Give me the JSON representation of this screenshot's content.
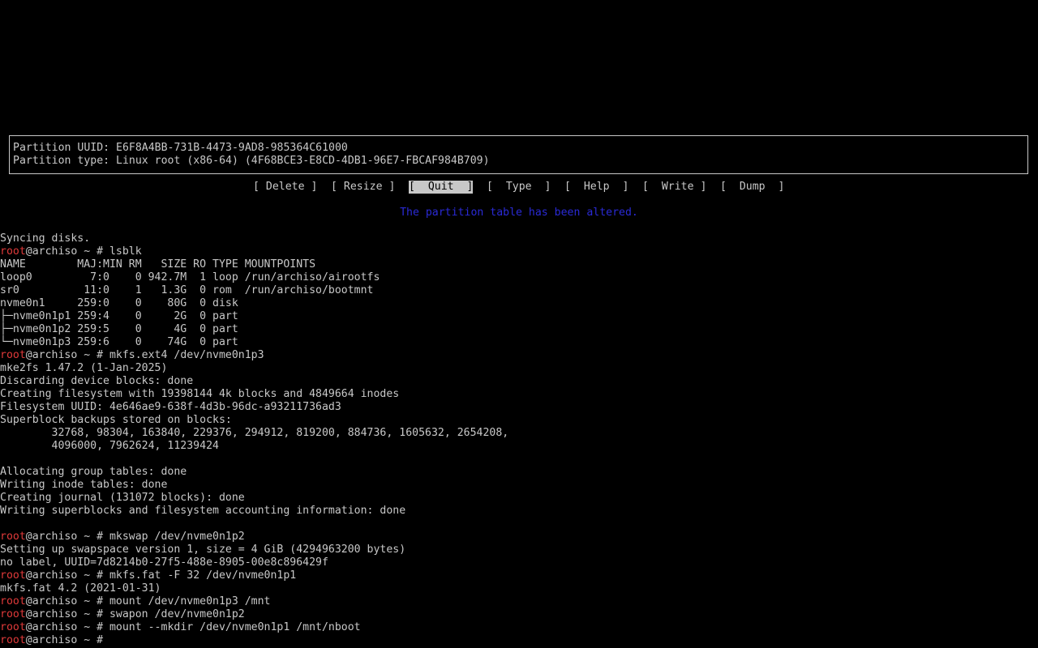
{
  "colors": {
    "background": "#000000",
    "foreground": "#c8c8c8",
    "prompt_user": "#e03a3a",
    "status_message": "#2a2ad6",
    "menu_selected_bg": "#c8c8c8"
  },
  "top_line": "── ──────── ── ─ ───────",
  "cfdisk": {
    "info_lines": [
      "Partition UUID: E6F8A4BB-731B-4473-9AD8-985364C61000",
      "Partition type: Linux root (x86-64) (4F68BCE3-E8CD-4DB1-96E7-FBCAF984B709)"
    ],
    "menu": [
      {
        "label": "[ Delete ]",
        "selected": false
      },
      {
        "label": "[ Resize ]",
        "selected": false
      },
      {
        "label": "[  Quit  ]",
        "selected": true
      },
      {
        "label": "[  Type  ]",
        "selected": false
      },
      {
        "label": "[  Help  ]",
        "selected": false
      },
      {
        "label": "[  Write ]",
        "selected": false
      },
      {
        "label": "[  Dump  ]",
        "selected": false
      }
    ],
    "status_message": "The partition table has been altered."
  },
  "terminal": {
    "prompt_user": "root",
    "prompt_rest": "@archiso ~ # ",
    "lines": [
      {
        "type": "output",
        "text": "Syncing disks."
      },
      {
        "type": "prompt",
        "cmd": "lsblk"
      },
      {
        "type": "output",
        "text": "NAME        MAJ:MIN RM   SIZE RO TYPE MOUNTPOINTS"
      },
      {
        "type": "output",
        "text": "loop0         7:0    0 942.7M  1 loop /run/archiso/airootfs"
      },
      {
        "type": "output",
        "text": "sr0          11:0    1   1.3G  0 rom  /run/archiso/bootmnt"
      },
      {
        "type": "output",
        "text": "nvme0n1     259:0    0    80G  0 disk"
      },
      {
        "type": "output",
        "text": "├─nvme0n1p1 259:4    0     2G  0 part"
      },
      {
        "type": "output",
        "text": "├─nvme0n1p2 259:5    0     4G  0 part"
      },
      {
        "type": "output",
        "text": "└─nvme0n1p3 259:6    0    74G  0 part"
      },
      {
        "type": "prompt",
        "cmd": "mkfs.ext4 /dev/nvme0n1p3"
      },
      {
        "type": "output",
        "text": "mke2fs 1.47.2 (1-Jan-2025)"
      },
      {
        "type": "output",
        "text": "Discarding device blocks: done"
      },
      {
        "type": "output",
        "text": "Creating filesystem with 19398144 4k blocks and 4849664 inodes"
      },
      {
        "type": "output",
        "text": "Filesystem UUID: 4e646ae9-638f-4d3b-96dc-a93211736ad3"
      },
      {
        "type": "output",
        "text": "Superblock backups stored on blocks:"
      },
      {
        "type": "output",
        "text": "        32768, 98304, 163840, 229376, 294912, 819200, 884736, 1605632, 2654208,"
      },
      {
        "type": "output",
        "text": "        4096000, 7962624, 11239424"
      },
      {
        "type": "output",
        "text": ""
      },
      {
        "type": "output",
        "text": "Allocating group tables: done"
      },
      {
        "type": "output",
        "text": "Writing inode tables: done"
      },
      {
        "type": "output",
        "text": "Creating journal (131072 blocks): done"
      },
      {
        "type": "output",
        "text": "Writing superblocks and filesystem accounting information: done"
      },
      {
        "type": "output",
        "text": ""
      },
      {
        "type": "prompt",
        "cmd": "mkswap /dev/nvme0n1p2"
      },
      {
        "type": "output",
        "text": "Setting up swapspace version 1, size = 4 GiB (4294963200 bytes)"
      },
      {
        "type": "output",
        "text": "no label, UUID=7d8214b0-27f5-488e-8905-00e8c896429f"
      },
      {
        "type": "prompt",
        "cmd": "mkfs.fat -F 32 /dev/nvme0n1p1"
      },
      {
        "type": "output",
        "text": "mkfs.fat 4.2 (2021-01-31)"
      },
      {
        "type": "prompt",
        "cmd": "mount /dev/nvme0n1p3 /mnt"
      },
      {
        "type": "prompt",
        "cmd": "swapon /dev/nvme0n1p2"
      },
      {
        "type": "prompt",
        "cmd": "mount --mkdir /dev/nvme0n1p1 /mnt/nboot"
      },
      {
        "type": "prompt",
        "cmd": ""
      }
    ]
  }
}
